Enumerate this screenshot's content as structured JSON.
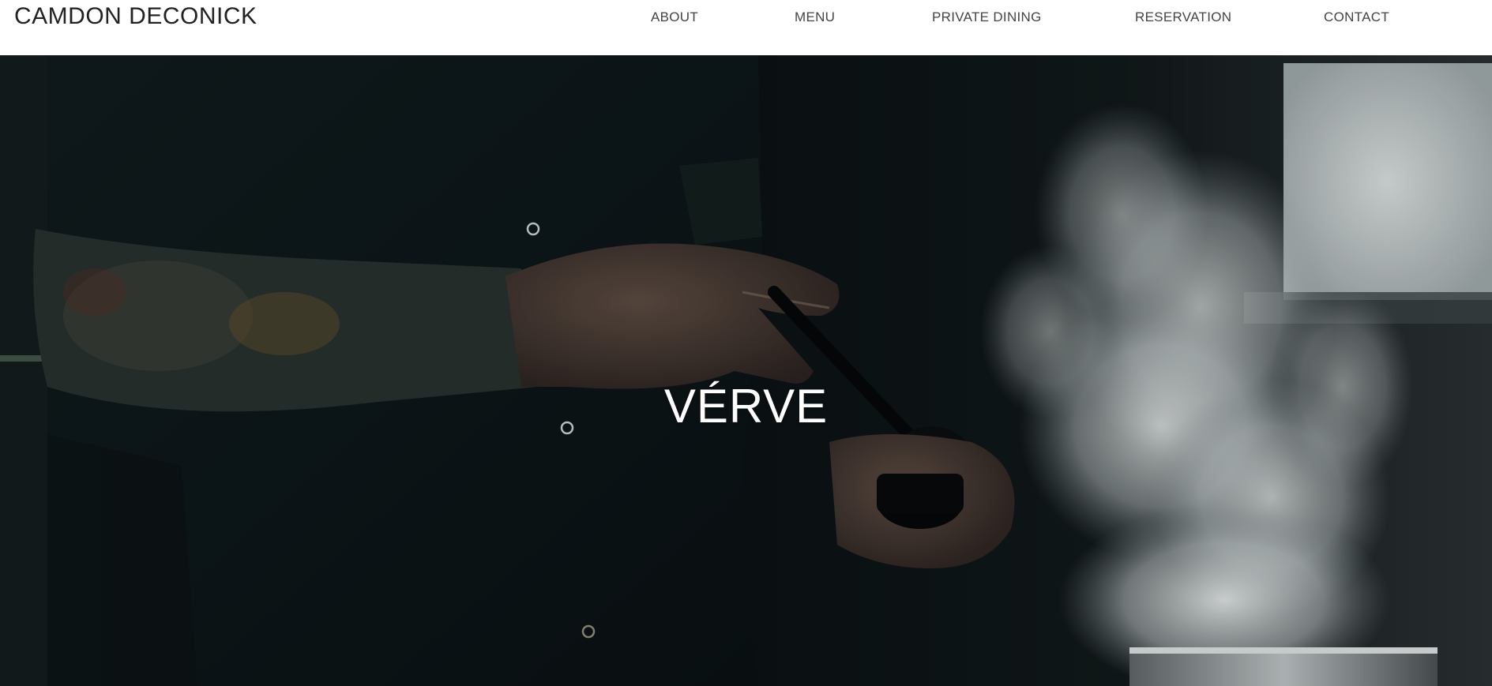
{
  "header": {
    "brand": "CAMDON DECONICK",
    "nav": [
      {
        "label": "ABOUT"
      },
      {
        "label": "MENU"
      },
      {
        "label": "PRIVATE DINING"
      },
      {
        "label": "RESERVATION"
      },
      {
        "label": "CONTACT"
      }
    ]
  },
  "hero": {
    "title": "VÉRVE"
  },
  "colors": {
    "nav_text": "#444444",
    "brand_text": "#222222",
    "hero_title": "#ffffff",
    "hero_background": "#0b1112"
  }
}
